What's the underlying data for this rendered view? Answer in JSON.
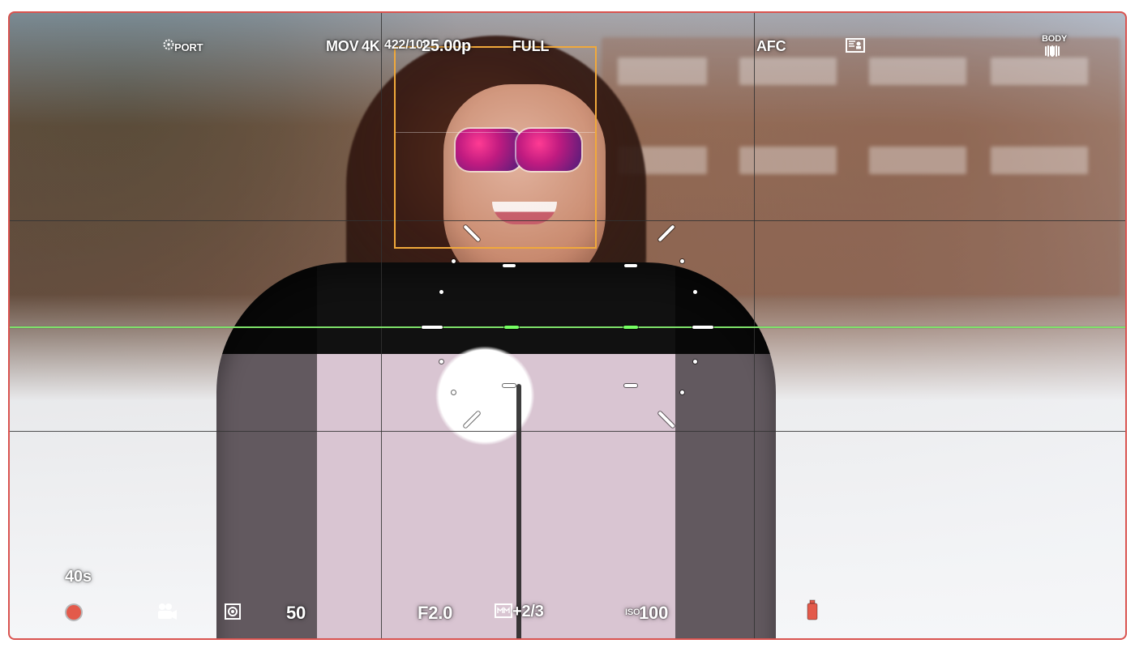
{
  "osd": {
    "top": {
      "portrait_label": "PORT",
      "format": "MOV",
      "resolution": "4K",
      "codec": "422/10L",
      "frame_rate": "25.00p",
      "sensor_mode": "FULL",
      "focus_mode": "AFC",
      "body_label": "BODY"
    },
    "bottom": {
      "rec_time": "40s",
      "shutter": "50",
      "aperture": "F2.0",
      "exposure_comp": "+2/3",
      "iso_prefix": "ISO",
      "iso_value": "100"
    }
  },
  "icons": {
    "portrait": "aperture-icon",
    "face_detect": "face-detect-icon",
    "body_stabilizer": "hand-stabilizer-icon",
    "movie": "movie-camera-icon",
    "metering": "metering-icon",
    "meter": "exposure-meter-icon",
    "battery": "battery-icon"
  },
  "colors": {
    "frame": "#d9534f",
    "rec": "#e35a4b",
    "focus_box": "#f1a93b",
    "horizon": "#7fe36b"
  }
}
